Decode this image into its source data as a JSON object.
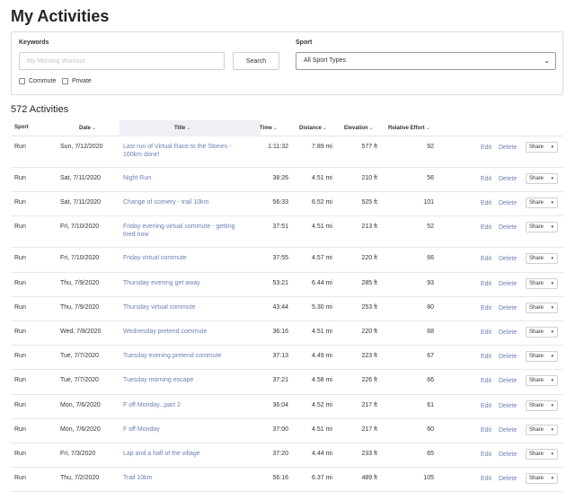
{
  "page": {
    "title": "My Activities"
  },
  "filters": {
    "keywords_label": "Keywords",
    "keywords_placeholder": "My Morning Workout",
    "keywords_value": "",
    "search_label": "Search",
    "sport_label": "Sport",
    "sport_selected": "All Sport Types",
    "commute_label": "Commute",
    "private_label": "Private"
  },
  "count_text": "572 Activities",
  "table": {
    "headers": {
      "sport": "Sport",
      "date": "Date",
      "title": "Title",
      "time": "Time",
      "distance": "Distance",
      "elevation": "Elevation",
      "effort": "Relative Effort"
    },
    "sort_glyph": "⌄",
    "edit_label": "Edit",
    "delete_label": "Delete",
    "share_label": "Share",
    "rows": [
      {
        "sport": "Run",
        "date": "Sun, 7/12/2020",
        "title": "Last run of Virtual Race to the Stones - 100km done!",
        "time": "1:11:32",
        "distance": "7.89 mi",
        "elevation": "577 ft",
        "effort": "92"
      },
      {
        "sport": "Run",
        "date": "Sat, 7/11/2020",
        "title": "Night Run",
        "time": "38:26",
        "distance": "4.51 mi",
        "elevation": "210 ft",
        "effort": "56"
      },
      {
        "sport": "Run",
        "date": "Sat, 7/11/2020",
        "title": "Change of scenery - trail 10km",
        "time": "56:33",
        "distance": "6.52 mi",
        "elevation": "525 ft",
        "effort": "101"
      },
      {
        "sport": "Run",
        "date": "Fri, 7/10/2020",
        "title": "Friday evening virtual commute - getting tired now",
        "time": "37:51",
        "distance": "4.51 mi",
        "elevation": "213 ft",
        "effort": "52"
      },
      {
        "sport": "Run",
        "date": "Fri, 7/10/2020",
        "title": "Friday virtual commute",
        "time": "37:55",
        "distance": "4.57 mi",
        "elevation": "220 ft",
        "effort": "66"
      },
      {
        "sport": "Run",
        "date": "Thu, 7/9/2020",
        "title": "Thursday evening get away",
        "time": "53:21",
        "distance": "6.44 mi",
        "elevation": "285 ft",
        "effort": "93"
      },
      {
        "sport": "Run",
        "date": "Thu, 7/9/2020",
        "title": "Thursday virtual commute",
        "time": "43:44",
        "distance": "5.30 mi",
        "elevation": "253 ft",
        "effort": "80"
      },
      {
        "sport": "Run",
        "date": "Wed, 7/8/2020",
        "title": "Wednesday pretend commute",
        "time": "36:16",
        "distance": "4.51 mi",
        "elevation": "220 ft",
        "effort": "68"
      },
      {
        "sport": "Run",
        "date": "Tue, 7/7/2020",
        "title": "Tuesday evening pretend commute",
        "time": "37:13",
        "distance": "4.49 mi",
        "elevation": "223 ft",
        "effort": "67"
      },
      {
        "sport": "Run",
        "date": "Tue, 7/7/2020",
        "title": "Tuesday morning escape",
        "time": "37:21",
        "distance": "4.58 mi",
        "elevation": "226 ft",
        "effort": "66"
      },
      {
        "sport": "Run",
        "date": "Mon, 7/6/2020",
        "title": "F off Monday...part 2",
        "time": "36:04",
        "distance": "4.52 mi",
        "elevation": "217 ft",
        "effort": "61"
      },
      {
        "sport": "Run",
        "date": "Mon, 7/6/2020",
        "title": "F off Monday",
        "time": "37:00",
        "distance": "4.51 mi",
        "elevation": "217 ft",
        "effort": "60"
      },
      {
        "sport": "Run",
        "date": "Fri, 7/3/2020",
        "title": "Lap and a half of the village",
        "time": "37:20",
        "distance": "4.44 mi",
        "elevation": "233 ft",
        "effort": "65"
      },
      {
        "sport": "Run",
        "date": "Thu, 7/2/2020",
        "title": "Trail 10km",
        "time": "56:16",
        "distance": "6.37 mi",
        "elevation": "489 ft",
        "effort": "105"
      }
    ]
  },
  "icons": {
    "select_chevron": "chevron-down-icon",
    "share_caret": "caret-down-icon",
    "sort": "sort-down-icon"
  }
}
